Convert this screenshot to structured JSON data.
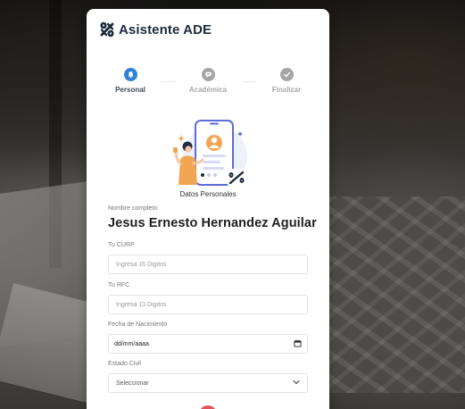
{
  "app": {
    "title": "Asistente ADE",
    "brand_color": "#1c2b3a",
    "logo_icon": "percent-knot-logo"
  },
  "stepper": {
    "steps": [
      {
        "label": "Personal",
        "icon": "bell-icon",
        "state": "active"
      },
      {
        "label": "Académica",
        "icon": "chat-icon",
        "state": "inactive"
      },
      {
        "label": "Finalizar",
        "icon": "check-icon",
        "state": "inactive"
      }
    ],
    "active_color": "#2f80d8",
    "inactive_color": "#a5a5a5"
  },
  "section": {
    "title": "Datos Personales",
    "illustration": "person-with-phone-illustration"
  },
  "form": {
    "fullname": {
      "label": "Nombre completo",
      "value": "Jesus Ernesto Hernandez Aguilar"
    },
    "curp": {
      "label": "Tu CURP",
      "placeholder": "Ingresa 16 Digitos"
    },
    "rfc": {
      "label": "Tu RFC",
      "placeholder": "Ingresa 13 Digitos"
    },
    "birthdate": {
      "label": "Fecha de Nacimiento",
      "value": "dd/mm/aaaa",
      "icon": "calendar-icon"
    },
    "civil_status": {
      "label": "Estado Civil",
      "selected": "Seleccionar",
      "icon": "chevron-down-icon"
    }
  },
  "next_button": {
    "color": "#e0535f"
  }
}
